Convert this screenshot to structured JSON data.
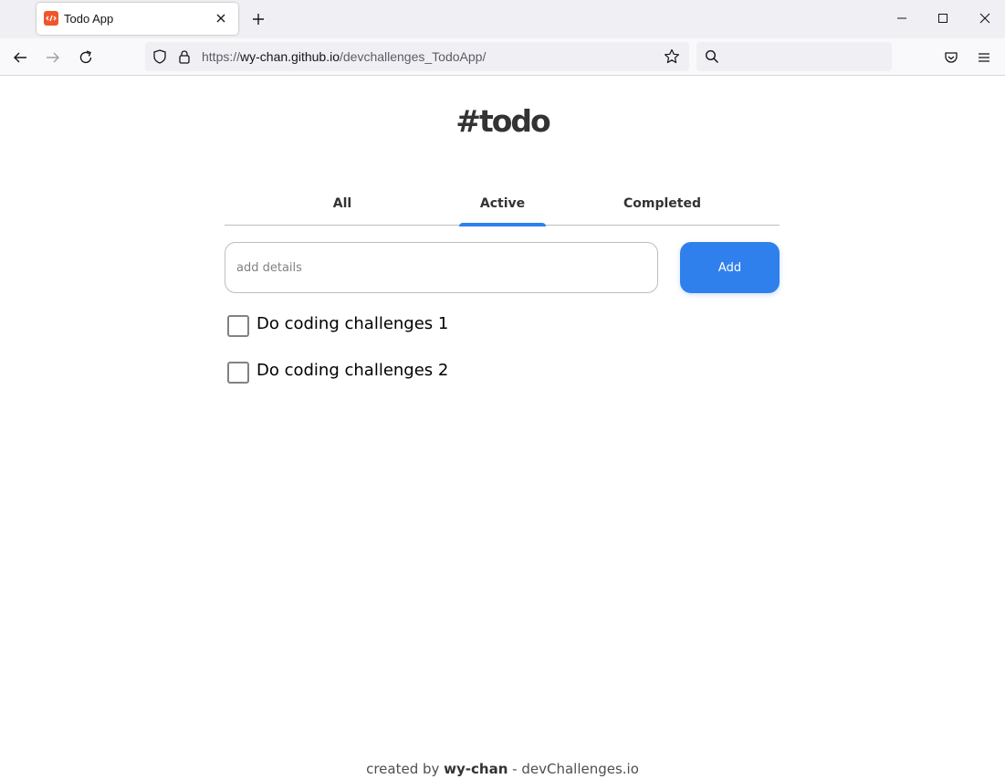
{
  "browser": {
    "tab_title": "Todo App",
    "url_prefix": "https://",
    "url_host": "wy-chan.github.io",
    "url_path": "/devchallenges_TodoApp/",
    "favicon_color": "#f0552b"
  },
  "app": {
    "title": "#todo",
    "tabs": [
      {
        "label": "All",
        "active": false
      },
      {
        "label": "Active",
        "active": true
      },
      {
        "label": "Completed",
        "active": false
      }
    ],
    "input_placeholder": "add details",
    "input_value": "",
    "add_label": "Add",
    "accent_color": "#2f80ed",
    "todos": [
      {
        "label": "Do coding challenges 1",
        "checked": false
      },
      {
        "label": "Do coding challenges 2",
        "checked": false
      }
    ],
    "footer": {
      "prefix": "created by ",
      "author": "wy-chan",
      "suffix": " - devChallenges.io"
    }
  }
}
